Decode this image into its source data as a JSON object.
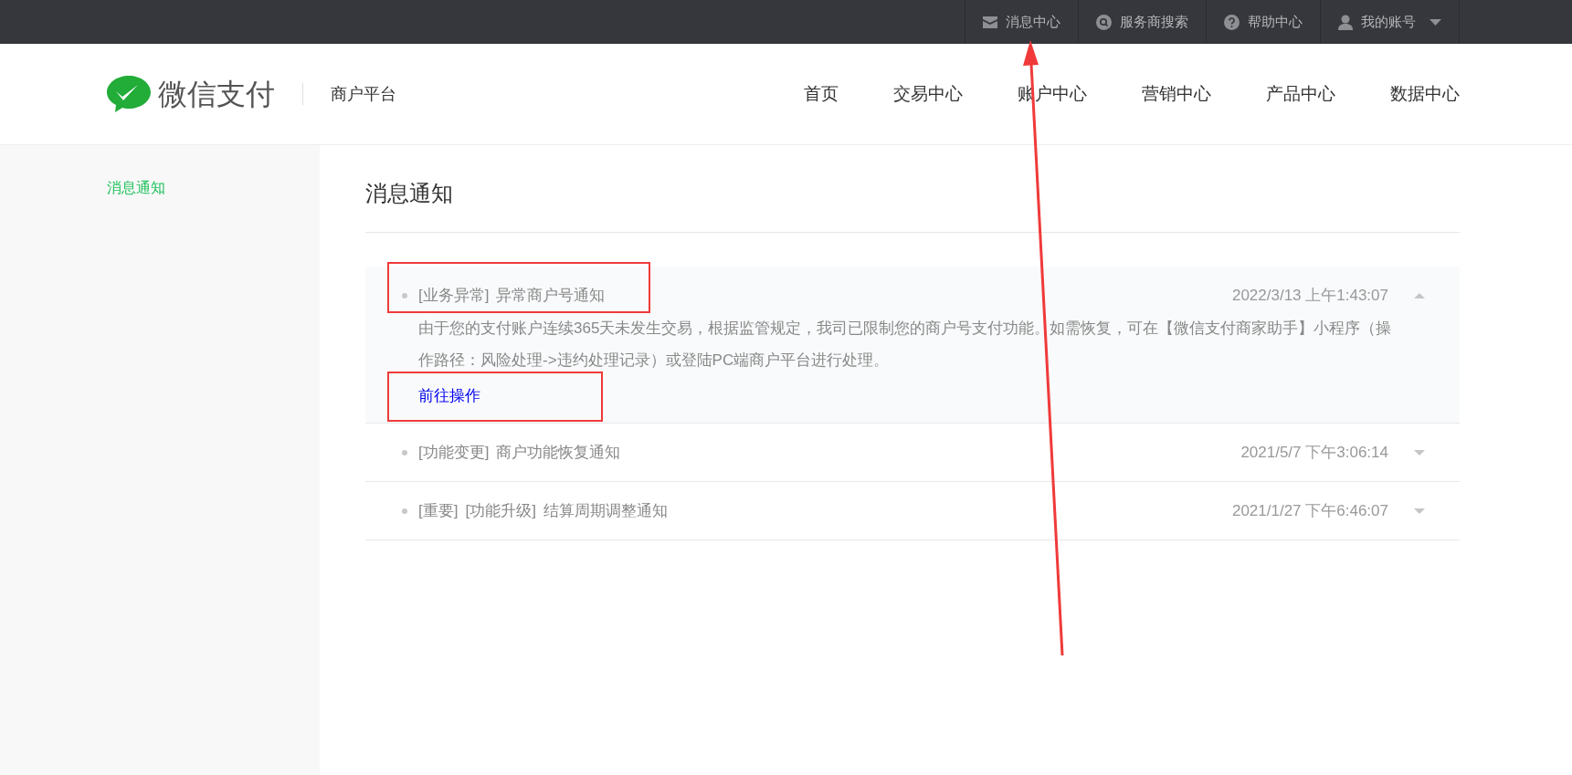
{
  "top_bar": {
    "items": [
      {
        "label": "消息中心",
        "dropdown": false
      },
      {
        "label": "服务商搜索",
        "dropdown": false
      },
      {
        "label": "帮助中心",
        "dropdown": false
      },
      {
        "label": "我的账号",
        "dropdown": true
      }
    ]
  },
  "header": {
    "logo_text": "微信支付",
    "platform": "商户平台",
    "nav": [
      {
        "label": "首页",
        "selected": false
      },
      {
        "label": "交易中心",
        "selected": false
      },
      {
        "label": "账户中心",
        "selected": false
      },
      {
        "label": "营销中心",
        "selected": false
      },
      {
        "label": "产品中心",
        "selected": false
      },
      {
        "label": "数据中心",
        "selected": false
      }
    ]
  },
  "sidebar": {
    "items": [
      {
        "label": "消息通知",
        "selected": true
      }
    ]
  },
  "page_title": "消息通知",
  "messages": [
    {
      "tags": [
        "[业务异常]"
      ],
      "title": "异常商户号通知",
      "time": "2022/3/13 上午1:43:07",
      "expanded": true,
      "body": "由于您的支付账户连续365天未发生交易，根据监管规定，我司已限制您的商户号支付功能。如需恢复，可在【微信支付商家助手】小程序（操作路径：风险处理->违约处理记录）或登陆PC端商户平台进行处理。",
      "link": "前往操作"
    },
    {
      "tags": [
        "[功能变更]"
      ],
      "title": "商户功能恢复通知",
      "time": "2021/5/7 下午3:06:14",
      "expanded": false
    },
    {
      "tags": [
        "[重要]",
        "[功能升级]"
      ],
      "title": "结算周期调整通知",
      "time": "2021/1/27 下午6:46:07",
      "expanded": false
    }
  ]
}
